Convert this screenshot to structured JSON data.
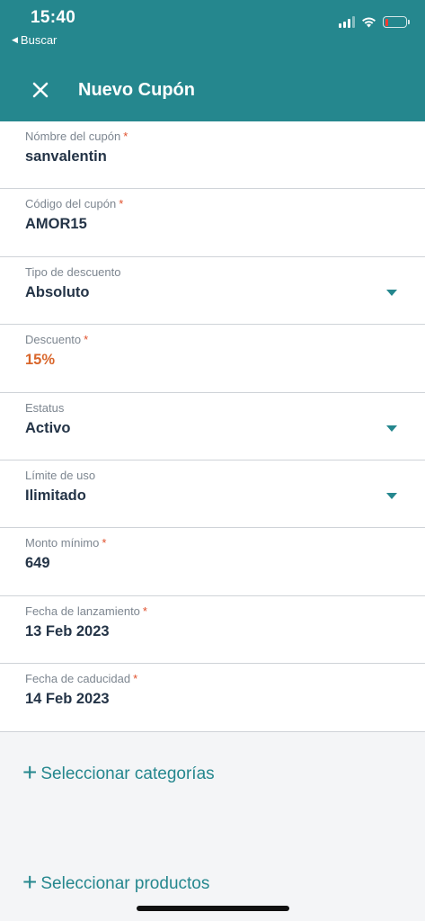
{
  "status_bar": {
    "time": "15:40",
    "back_label": "Buscar",
    "icons": [
      "signal-icon",
      "wifi-icon",
      "battery-icon"
    ]
  },
  "nav": {
    "title": "Nuevo Cupón",
    "close_icon": "close-icon"
  },
  "form": {
    "fields": [
      {
        "label": "Nómbre del cupón",
        "required": "*",
        "value": "sanvalentin"
      },
      {
        "label": "Código del cupón",
        "required": "*",
        "value": "AMOR15"
      },
      {
        "label": "Tipo de descuento",
        "required": "",
        "value": "Absoluto"
      },
      {
        "label": "Descuento",
        "required": "*",
        "value": "15%"
      },
      {
        "label": "Estatus",
        "required": "",
        "value": "Activo"
      },
      {
        "label": "Límite de uso",
        "required": "",
        "value": "Ilimitado"
      },
      {
        "label": "Monto mínimo",
        "required": "*",
        "value": "649"
      },
      {
        "label": "Fecha de lanzamiento",
        "required": "*",
        "value": "13 Feb 2023"
      },
      {
        "label": "Fecha de caducidad",
        "required": "*",
        "value": "14 Feb 2023"
      }
    ]
  },
  "actions": {
    "select_categories": "Seleccionar categorías",
    "select_products": "Seleccionar productos"
  },
  "colors": {
    "brand": "#25878e",
    "accent": "#d9662b",
    "required": "#e0502c"
  }
}
